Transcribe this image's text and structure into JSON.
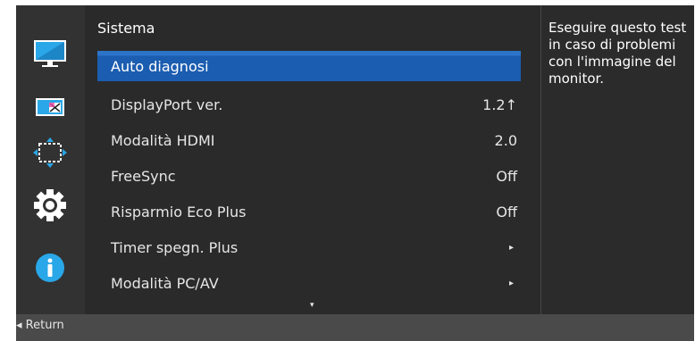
{
  "main": {
    "title": "Sistema",
    "items": [
      {
        "label": "Auto diagnosi",
        "value": "",
        "selected": true
      },
      {
        "label": "DisplayPort ver.",
        "value": "1.2↑"
      },
      {
        "label": "Modalità HDMI",
        "value": "2.0"
      },
      {
        "label": "FreeSync",
        "value": "Off"
      },
      {
        "label": "Risparmio Eco Plus",
        "value": "Off"
      },
      {
        "label": "Timer spegn. Plus",
        "value": "▸"
      },
      {
        "label": "Modalità PC/AV",
        "value": "▸"
      }
    ],
    "scroll_indicator": "▾"
  },
  "description": "Eseguire questo test in caso di problemi con l'immagine del monitor.",
  "footer": {
    "return_label": "◂ Return"
  },
  "sidebar": {
    "icons": [
      "picture-icon",
      "screen-size-icon",
      "position-icon",
      "settings-gear-icon",
      "info-icon"
    ]
  },
  "colors": {
    "selected": "#1b5db0",
    "background": "#2a2a2a",
    "footer": "#4a4a4a"
  }
}
